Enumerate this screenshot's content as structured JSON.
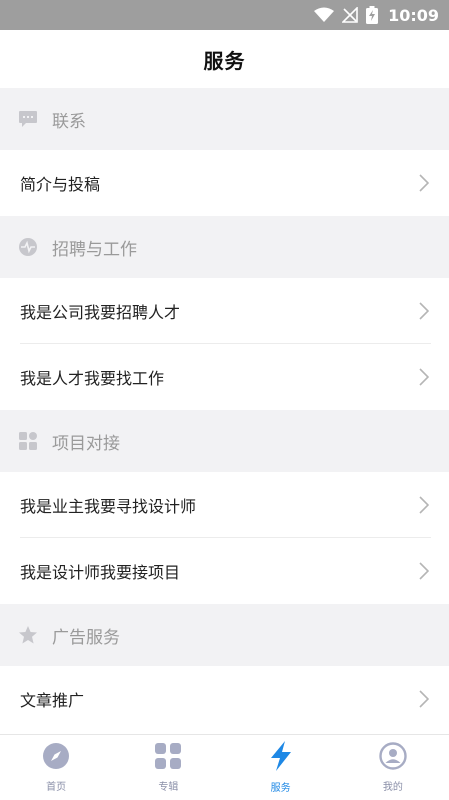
{
  "status_bar": {
    "time": "10:09"
  },
  "header": {
    "title": "服务"
  },
  "sections": [
    {
      "label": "联系",
      "icon": "chat-bubble-icon",
      "items": [
        {
          "label": "简介与投稿"
        }
      ]
    },
    {
      "label": "招聘与工作",
      "icon": "heartbeat-icon",
      "items": [
        {
          "label": "我是公司我要招聘人才"
        },
        {
          "label": "我是人才我要找工作"
        }
      ]
    },
    {
      "label": "项目对接",
      "icon": "grid-tiles-icon",
      "items": [
        {
          "label": "我是业主我要寻找设计师"
        },
        {
          "label": "我是设计师我要接项目"
        }
      ]
    },
    {
      "label": "广告服务",
      "icon": "star-icon",
      "items": [
        {
          "label": "文章推广"
        }
      ]
    }
  ],
  "tabs": [
    {
      "label": "首页",
      "icon": "compass-icon",
      "active": false
    },
    {
      "label": "专辑",
      "icon": "grid-icon",
      "active": false
    },
    {
      "label": "服务",
      "icon": "lightning-icon",
      "active": true
    },
    {
      "label": "我的",
      "icon": "profile-icon",
      "active": false
    }
  ],
  "colors": {
    "status_bar": "#9e9e9e",
    "section_bg": "#f2f2f4",
    "section_text": "#9a9a9a",
    "tab_inactive": "#8a8fa8",
    "tab_active": "#1e88e5"
  }
}
